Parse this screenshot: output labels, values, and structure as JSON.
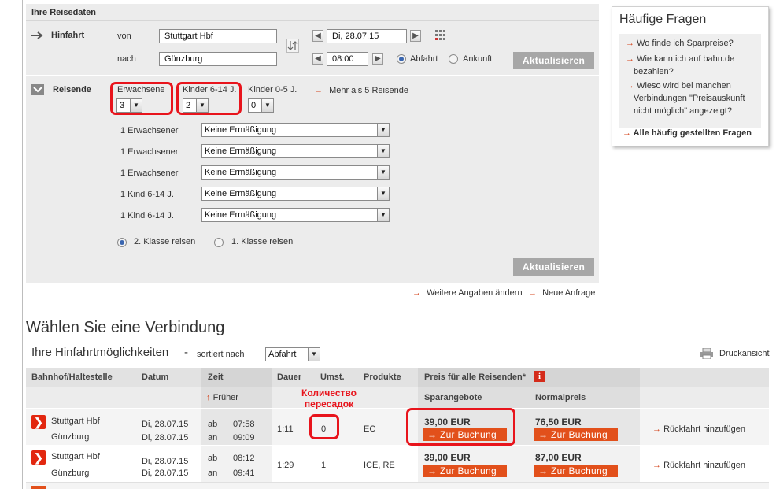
{
  "reisedaten": {
    "header": "Ihre Reisedaten",
    "hinfahrt_label": "Hinfahrt",
    "von_label": "von",
    "von_value": "Stuttgart Hbf",
    "nach_label": "nach",
    "nach_value": "Günzburg",
    "date_value": "Di, 28.07.15",
    "time_value": "08:00",
    "abfahrt_label": "Abfahrt",
    "ankunft_label": "Ankunft",
    "aktualisieren": "Aktualisieren"
  },
  "reisende": {
    "label": "Reisende",
    "erwachsene_label": "Erwachsene",
    "erwachsene_value": "3",
    "kinder_label": "Kinder 6-14 J.",
    "kinder_value": "2",
    "kinder05_label": "Kinder 0-5 J.",
    "kinder05_value": "0",
    "mehr_link": "Mehr als 5 Reisende",
    "travelers": [
      {
        "label": "1 Erwachsener",
        "discount": "Keine Ermäßigung"
      },
      {
        "label": "1 Erwachsener",
        "discount": "Keine Ermäßigung"
      },
      {
        "label": "1 Erwachsener",
        "discount": "Keine Ermäßigung"
      },
      {
        "label": "1 Kind 6-14 J.",
        "discount": "Keine Ermäßigung"
      },
      {
        "label": "1 Kind 6-14 J.",
        "discount": "Keine Ermäßigung"
      }
    ],
    "klasse2": "2. Klasse reisen",
    "klasse1": "1. Klasse reisen",
    "aktualisieren": "Aktualisieren"
  },
  "links": {
    "weitere": "Weitere Angaben ändern",
    "neue": "Neue Anfrage"
  },
  "faq": {
    "title": "Häufige Fragen",
    "q1": "Wo finde ich Sparpreise?",
    "q2a": "Wie kann ich auf bahn.de",
    "q2b": "bezahlen?",
    "q3a": "Wieso wird bei manchen",
    "q3b": "Verbindungen \"Preisauskunft",
    "q3c": "nicht möglich\" angezeigt?",
    "all": "Alle häufig gestellten Fragen"
  },
  "results": {
    "title": "Wählen Sie eine Verbindung",
    "subtitle": "Ihre Hinfahrtmöglichkeiten",
    "dash": "-",
    "sort_label": "sortiert nach",
    "sort_value": "Abfahrt",
    "print": "Druckansicht",
    "columns": {
      "station": "Bahnhof/Haltestelle",
      "datum": "Datum",
      "zeit": "Zeit",
      "dauer": "Dauer",
      "umst": "Umst.",
      "produkte": "Produkte",
      "preis": "Preis für alle Reisenden*",
      "spar": "Sparangebote",
      "normal": "Normalpreis",
      "frueher": "Früher"
    },
    "annotation_line1": "Количество",
    "annotation_line2": "пересадок",
    "rows": [
      {
        "from": "Stuttgart Hbf",
        "to": "Günzburg",
        "date_from": "Di, 28.07.15",
        "date_to": "Di, 28.07.15",
        "ab_label": "ab",
        "an_label": "an",
        "dep": "07:58",
        "arr": "09:09",
        "dauer": "1:11",
        "umst": "0",
        "produkte": "EC",
        "spar": "39,00 EUR",
        "normal": "76,50 EUR",
        "book": "Zur Buchung",
        "rueck": "Rückfahrt hinzufügen"
      },
      {
        "from": "Stuttgart Hbf",
        "to": "Günzburg",
        "date_from": "Di, 28.07.15",
        "date_to": "Di, 28.07.15",
        "ab_label": "ab",
        "an_label": "an",
        "dep": "08:12",
        "arr": "09:41",
        "dauer": "1:29",
        "umst": "1",
        "produkte": "ICE, RE",
        "spar": "39,00 EUR",
        "normal": "87,00 EUR",
        "book": "Zur Buchung",
        "rueck": "Rückfahrt hinzufügen"
      }
    ]
  },
  "colors": {
    "accent": "#e2501b",
    "highlight": "#e8141c",
    "panel": "#ececec"
  }
}
